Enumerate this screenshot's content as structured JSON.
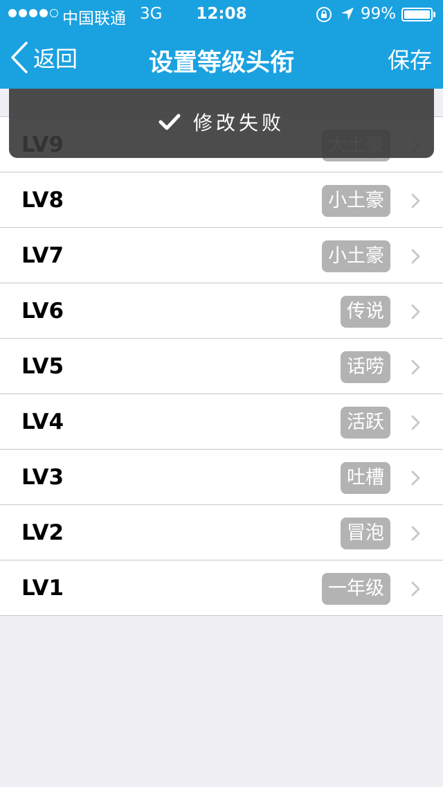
{
  "status_bar": {
    "signal_dots": [
      true,
      true,
      true,
      true,
      false
    ],
    "carrier": "中国联通",
    "network": "3G",
    "time": "12:08",
    "battery": "99%"
  },
  "nav": {
    "back_label": "返回",
    "title": "设置等级头衔",
    "save_label": "保存"
  },
  "toast": {
    "icon": "checkmark-icon",
    "text": "修改失败"
  },
  "levels": [
    {
      "level": "LV9",
      "title": "大土豪"
    },
    {
      "level": "LV8",
      "title": "小土豪"
    },
    {
      "level": "LV7",
      "title": "小土豪"
    },
    {
      "level": "LV6",
      "title": "传说"
    },
    {
      "level": "LV5",
      "title": "话唠"
    },
    {
      "level": "LV4",
      "title": "活跃"
    },
    {
      "level": "LV3",
      "title": "吐槽"
    },
    {
      "level": "LV2",
      "title": "冒泡"
    },
    {
      "level": "LV1",
      "title": "一年级"
    }
  ],
  "colors": {
    "nav_blue": "#1aa1e0",
    "badge_gray": "#b3b3b3",
    "background": "#efeff4"
  }
}
